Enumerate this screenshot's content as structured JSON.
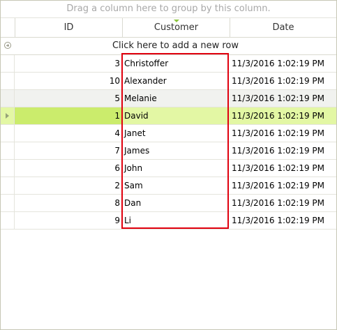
{
  "group_panel": {
    "text": "Drag a column here to group by this column."
  },
  "columns": [
    "ID",
    "Customer",
    "Date"
  ],
  "new_row": {
    "text": "Click here to add a new row"
  },
  "rows": [
    {
      "id": "3",
      "customer": "Christoffer",
      "date": "11/3/2016 1:02:19 PM"
    },
    {
      "id": "10",
      "customer": "Alexander",
      "date": "11/3/2016 1:02:19 PM"
    },
    {
      "id": "5",
      "customer": "Melanie",
      "date": "11/3/2016 1:02:19 PM"
    },
    {
      "id": "1",
      "customer": "David",
      "date": "11/3/2016 1:02:19 PM"
    },
    {
      "id": "4",
      "customer": "Janet",
      "date": "11/3/2016 1:02:19 PM"
    },
    {
      "id": "7",
      "customer": "James",
      "date": "11/3/2016 1:02:19 PM"
    },
    {
      "id": "6",
      "customer": "John",
      "date": "11/3/2016 1:02:19 PM"
    },
    {
      "id": "2",
      "customer": "Sam",
      "date": "11/3/2016 1:02:19 PM"
    },
    {
      "id": "8",
      "customer": "Dan",
      "date": "11/3/2016 1:02:19 PM"
    },
    {
      "id": "9",
      "customer": "Li",
      "date": "11/3/2016 1:02:19 PM"
    }
  ],
  "current_row_index": 3,
  "hover_row_index": 2,
  "sorted_column": "Customer",
  "colors": {
    "current_row": "#e3f7a4",
    "current_cell": "#cbec6c",
    "hover_row": "#f1f2ef",
    "highlight_box": "#e0000e",
    "sort_arrow": "#8cc63e"
  },
  "icons": {
    "new_row": "plus-circle-icon",
    "current_row": "current-row-arrow-icon",
    "sort": "sort-indicator-icon"
  }
}
